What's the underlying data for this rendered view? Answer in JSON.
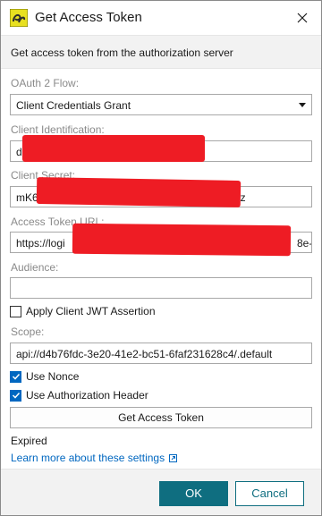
{
  "window": {
    "title": "Get Access Token",
    "subtitle": "Get access token from the authorization server"
  },
  "form": {
    "oauth_flow": {
      "label": "OAuth 2 Flow:",
      "value": "Client Credentials Grant"
    },
    "client_id": {
      "label": "Client Identification:",
      "value": "d8"
    },
    "client_secret": {
      "label": "Client Secret:",
      "value": "mK6",
      "value_tail": "lz"
    },
    "access_token_url": {
      "label": "Access Token URL:",
      "value": "https://logi",
      "value_tail": "8e-"
    },
    "audience": {
      "label": "Audience:",
      "value": ""
    },
    "apply_jwt": {
      "label": "Apply Client JWT Assertion",
      "checked": false
    },
    "scope": {
      "label": "Scope:",
      "value": "api://d4b76fdc-3e20-41e2-bc51-6faf231628c4/.default"
    },
    "use_nonce": {
      "label": "Use Nonce",
      "checked": true
    },
    "use_auth_header": {
      "label": "Use Authorization Header",
      "checked": true
    },
    "get_token_button": "Get Access Token"
  },
  "status": "Expired",
  "learn_more": "Learn more about these settings",
  "footer": {
    "ok": "OK",
    "cancel": "Cancel"
  },
  "colors": {
    "accent": "#0f6e80",
    "link": "#0067c0",
    "redaction": "#ee1c24"
  }
}
